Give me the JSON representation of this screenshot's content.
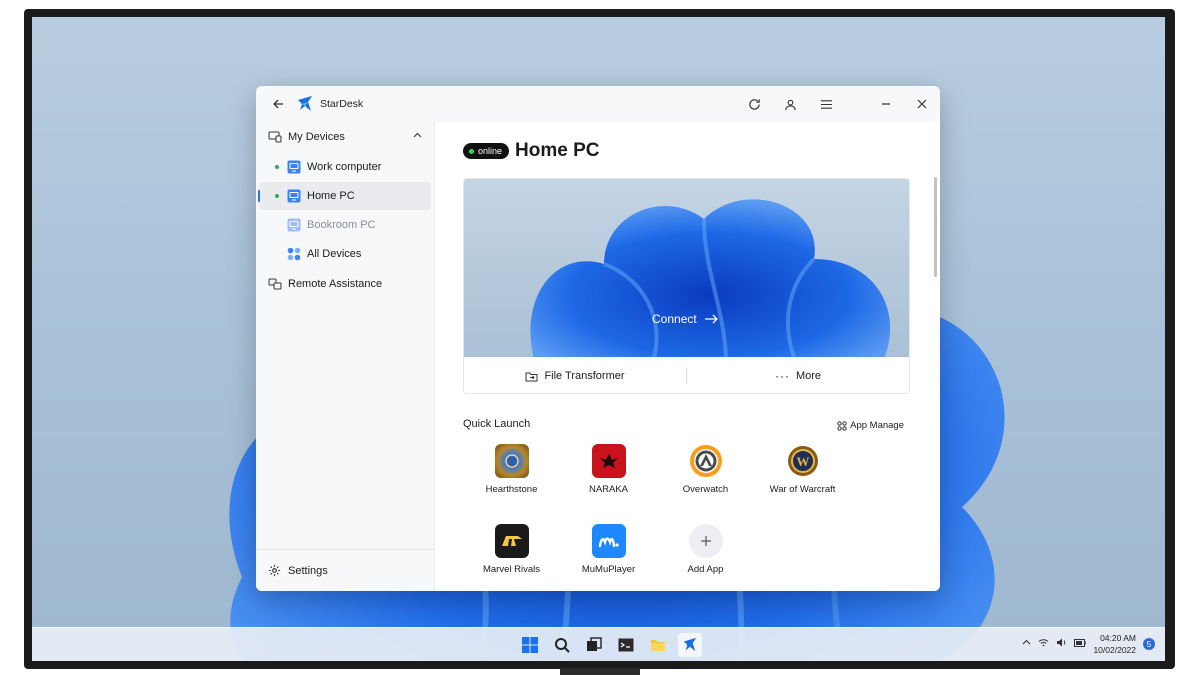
{
  "app": {
    "title": "StarDesk"
  },
  "sidebar": {
    "group": "My Devices",
    "devices": [
      {
        "label": "Work computer",
        "online": true
      },
      {
        "label": "Home PC",
        "online": true,
        "selected": true
      },
      {
        "label": "Bookroom PC",
        "online": false
      },
      {
        "label": "All Devices",
        "online": false
      }
    ],
    "remote_assistance": "Remote Assistance",
    "settings": "Settings"
  },
  "main": {
    "status": "online",
    "device_title": "Home PC",
    "connect_label": "Connect",
    "file_transfer_label": "File Transformer",
    "more_label": "More",
    "quick_launch_title": "Quick Launch",
    "app_manage_label": "App Manage",
    "apps": [
      {
        "name": "Hearthstone",
        "icon": "hearthstone-icon"
      },
      {
        "name": "NARAKA",
        "icon": "naraka-icon"
      },
      {
        "name": "Overwatch",
        "icon": "overwatch-icon"
      },
      {
        "name": "War of Warcraft",
        "icon": "warcraft-icon"
      },
      {
        "name": "Marvel Rivals",
        "icon": "marvel-rivals-icon"
      },
      {
        "name": "MuMuPlayer",
        "icon": "mumuplayer-icon"
      },
      {
        "name": "Add App",
        "icon": "add-icon"
      }
    ]
  },
  "taskbar": {
    "time": "04:20 AM",
    "date": "10/02/2022",
    "notifications": "5"
  },
  "colors": {
    "accent": "#2f6fe0",
    "online": "#2bb24c"
  }
}
